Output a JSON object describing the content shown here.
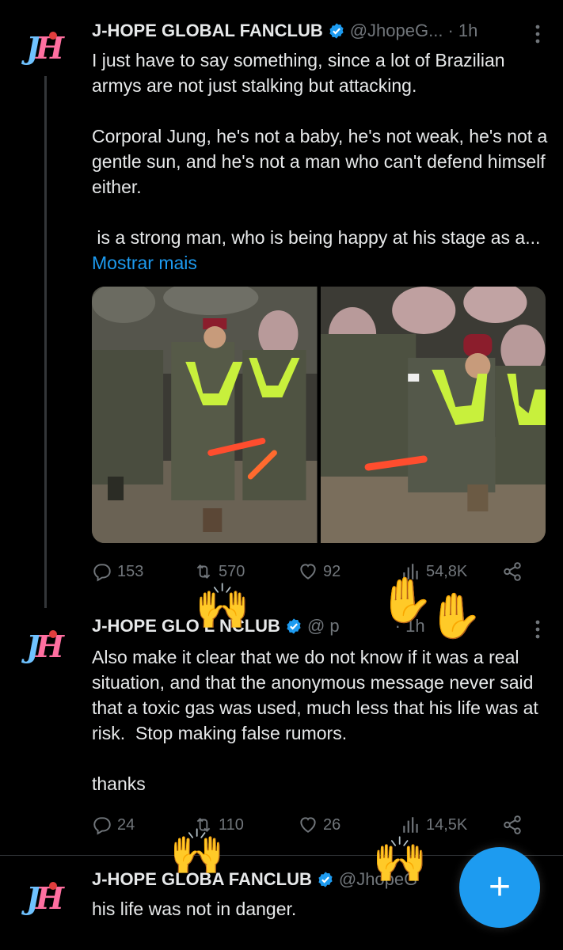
{
  "tweets": [
    {
      "author_name": "J-HOPE GLOBAL FANCLUB",
      "handle": "@JhopeG...",
      "time": "· 1h",
      "text": "I just have to say something, since a lot of Brazilian armys are not just stalking but attacking.\n\nCorporal Jung, he's not a baby, he's not weak, he's not a gentle sun, and he's not a man who can't defend himself either.\n\n is a strong man, who is being happy at his stage as a...",
      "show_more": "Mostrar mais",
      "replies": "153",
      "retweets": "570",
      "likes": "92",
      "views": "54,8K"
    },
    {
      "author_name": "J-HOPE GLO  L  NCLUB",
      "handle": "@  p",
      "time": "· 1h",
      "text": "Also make it clear that we do not know if it was a real situation, and that the anonymous message never said that a toxic gas was used, much less that his life was at risk.  Stop making false rumors.\n\nthanks",
      "replies": "24",
      "retweets": "110",
      "likes": "26",
      "views": "14,5K"
    },
    {
      "author_name": "J-HOPE GLOBA  FANCLUB",
      "handle": "@JhopeG",
      "text": "his life was not in danger."
    }
  ],
  "avatar_label": "JH",
  "fab_label": "+",
  "emojis": {
    "hands": "🙌",
    "raised": "✋"
  },
  "colors": {
    "accent": "#1d9bf0",
    "muted": "#71767b",
    "vest": "#c8f03c"
  },
  "icons": [
    "reply-icon",
    "retweet-icon",
    "like-icon",
    "views-icon",
    "share-icon",
    "verified-icon",
    "more-icon"
  ]
}
